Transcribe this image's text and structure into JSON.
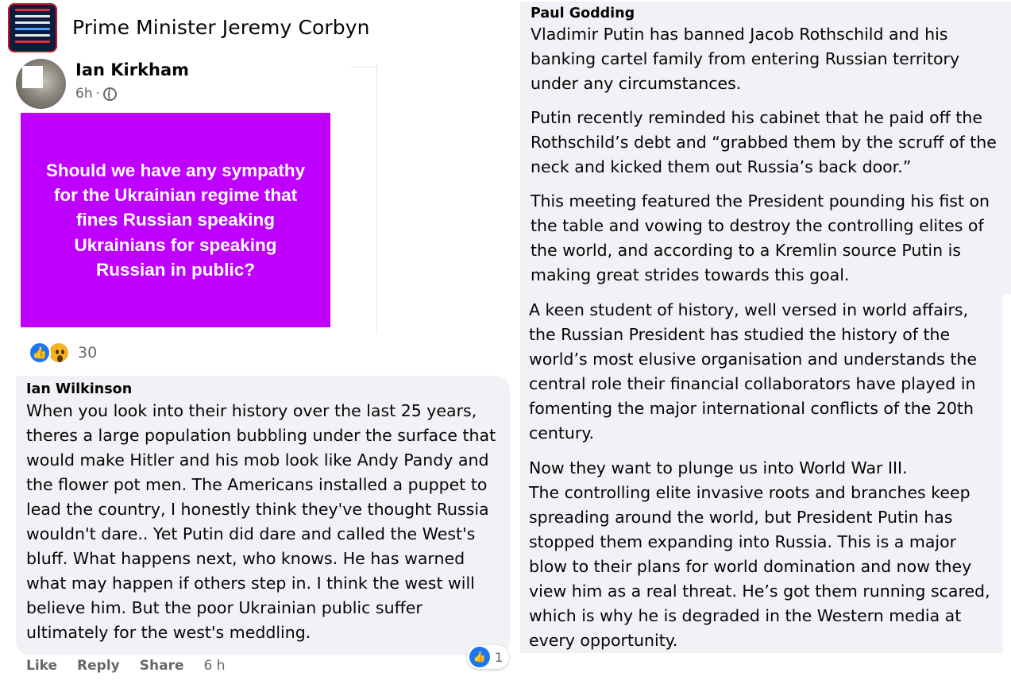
{
  "group": {
    "name": "Prime Minister Jeremy Corbyn"
  },
  "post": {
    "author": "Ian Kirkham",
    "time": "6h",
    "time_separator": "·",
    "image_text": "Should we have any sympathy for the Ukrainian regime that fines Russian speaking Ukrainians for speaking Russian in public?",
    "reaction_count": "30",
    "image_bg_color": "#bf00ff"
  },
  "comment_left": {
    "author": "Ian Wilkinson",
    "body": "When you look into their history over the last 25 years, theres a large population bubbling under the surface that would make Hitler and his mob look like Andy Pandy and the flower pot men. The Americans installed a puppet to lead the country, I honestly think they've thought Russia wouldn't dare.. Yet Putin did dare and called the West's bluff. What happens next, who knows. He has warned what may happen if others step in. I think the west will believe him. But the poor Ukrainian public suffer ultimately for the west's meddling.",
    "like_count": "1",
    "actions": {
      "like": "Like",
      "reply": "Reply",
      "share": "Share",
      "time": "6 h"
    }
  },
  "comment_right": {
    "author": "Paul Godding",
    "paragraphs": [
      "Vladimir Putin has banned Jacob Rothschild and his banking cartel family from entering Russian territory under any circumstances.",
      "Putin recently reminded his cabinet that he paid off the Rothschild’s debt and “grabbed them by the scruff of the neck and kicked them out Russia’s back door.”",
      "This meeting featured the President pounding his fist on the table and vowing to destroy the controlling elites of the world, and according to a Kremlin source Putin is making great strides towards this goal."
    ],
    "paragraphs_cont": [
      "A keen student of history, well versed in world affairs, the Russian President has studied the history of the world’s most elusive organisation and understands the central role their financial collaborators have played in fomenting the major international conflicts of the 20th century.",
      "Now they want to plunge us into World War III.",
      "The controlling elite invasive roots and branches keep spreading around the world, but President Putin has stopped them expanding into Russia. This is a major blow to their plans for world domination and now they view him as a real threat. He’s got them running scared, which is why he is degraded in the Western media at every opportunity."
    ]
  },
  "icons": {
    "privacy": "globe-icon",
    "like_reaction": "like-icon",
    "wow_reaction": "wow-icon"
  },
  "colors": {
    "bubble_bg": "#f0f2f5",
    "like_blue": "#1877f2",
    "secondary_text": "#65676b"
  }
}
